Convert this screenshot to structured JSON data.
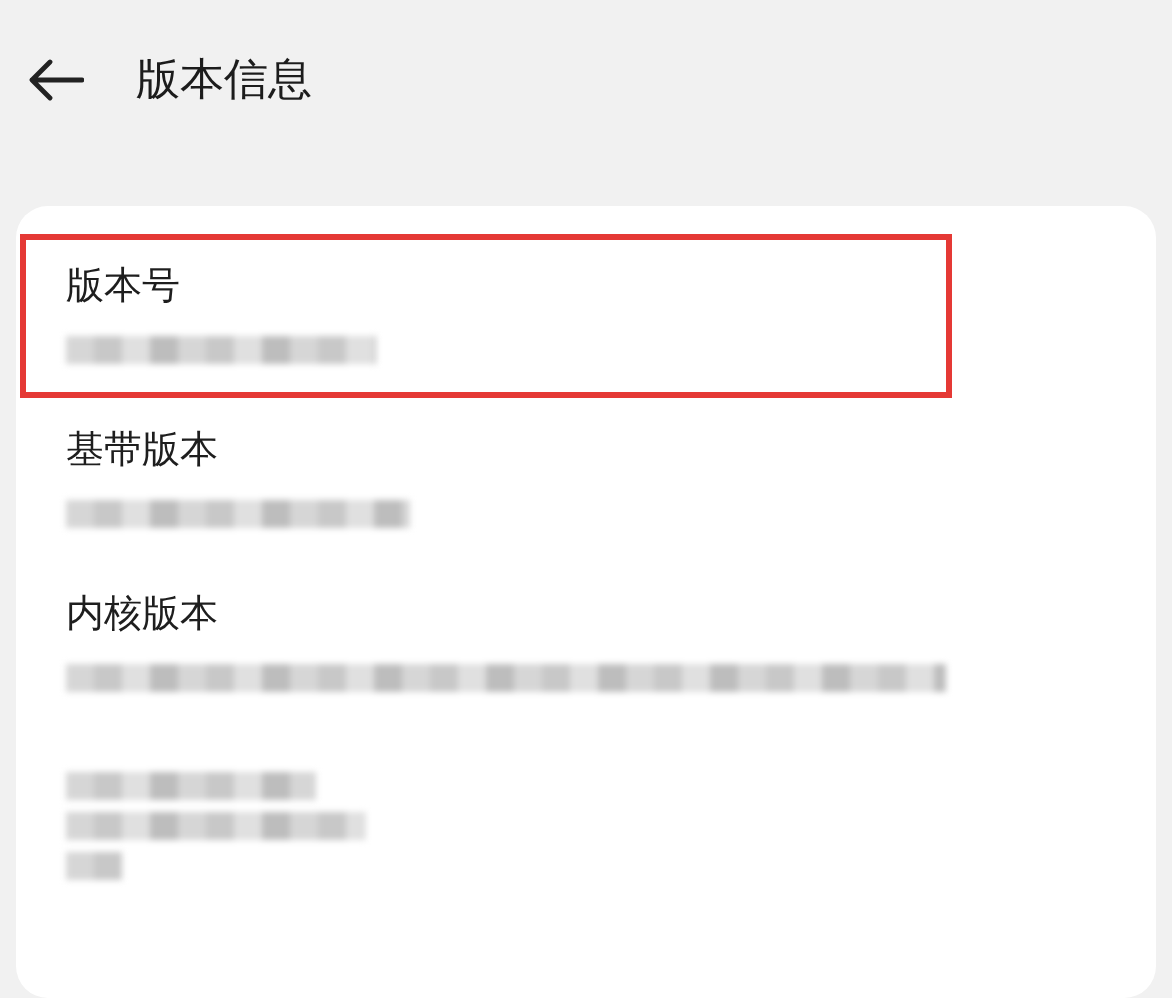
{
  "header": {
    "title": "版本信息"
  },
  "items": [
    {
      "kind": "labeled",
      "title": "版本号",
      "highlighted": true
    },
    {
      "kind": "labeled",
      "title": "基带版本",
      "highlighted": false
    },
    {
      "kind": "labeled",
      "title": "内核版本",
      "highlighted": false
    },
    {
      "kind": "redacted",
      "highlighted": false
    }
  ]
}
